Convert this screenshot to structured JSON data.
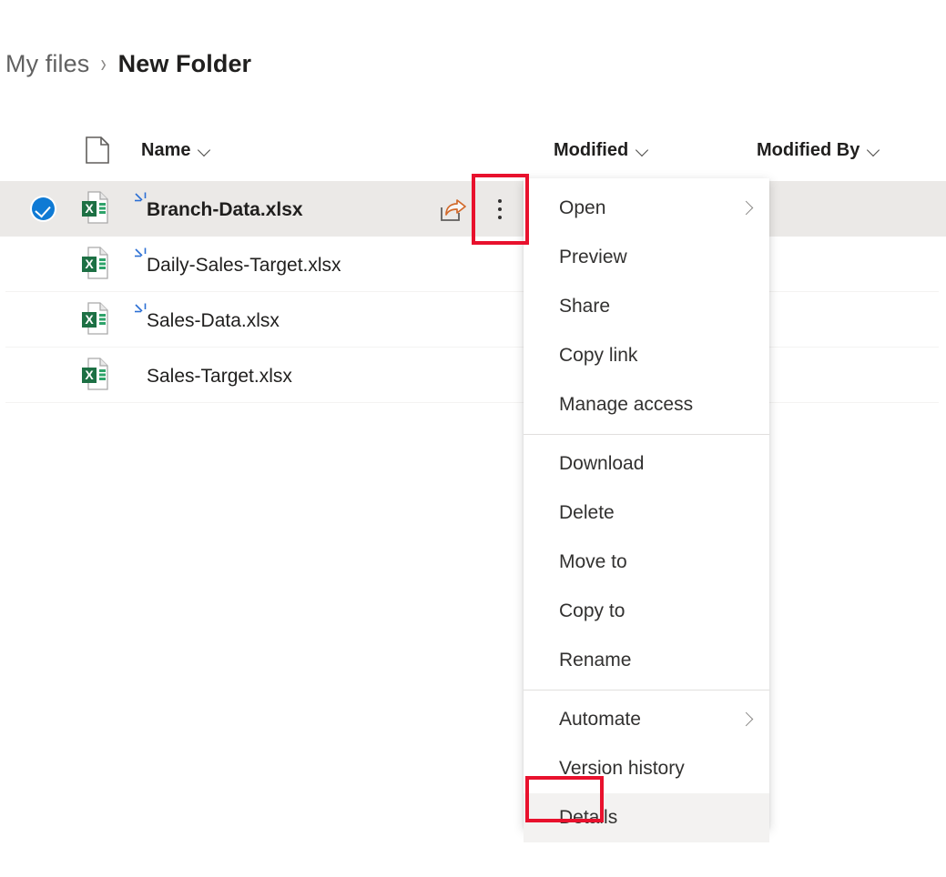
{
  "breadcrumb": {
    "root": "My files",
    "separator": "›",
    "current": "New Folder"
  },
  "columns": {
    "file_icon_name": "page-icon",
    "name": "Name",
    "modified": "Modified",
    "modified_by": "Modified By",
    "sort_chevron_icon": "chevron-down-icon"
  },
  "files": [
    {
      "name": "Branch-Data.xlsx",
      "type_icon": "excel-file-icon",
      "selected": true,
      "new_indicator": true,
      "modified": "",
      "modified_by": "",
      "share_icon": "share-icon",
      "more_icon": "more-vertical-icon"
    },
    {
      "name": "Daily-Sales-Target.xlsx",
      "type_icon": "excel-file-icon",
      "selected": false,
      "new_indicator": true,
      "modified": "",
      "modified_by": ""
    },
    {
      "name": "Sales-Data.xlsx",
      "type_icon": "excel-file-icon",
      "selected": false,
      "new_indicator": true,
      "modified": "",
      "modified_by": ""
    },
    {
      "name": "Sales-Target.xlsx",
      "type_icon": "excel-file-icon",
      "selected": false,
      "new_indicator": false,
      "modified": "",
      "modified_by": ""
    }
  ],
  "context_menu": {
    "groups": [
      {
        "items": [
          {
            "label": "Open",
            "submenu": true
          },
          {
            "label": "Preview",
            "submenu": false
          },
          {
            "label": "Share",
            "submenu": false
          },
          {
            "label": "Copy link",
            "submenu": false
          },
          {
            "label": "Manage access",
            "submenu": false
          }
        ]
      },
      {
        "items": [
          {
            "label": "Download",
            "submenu": false
          },
          {
            "label": "Delete",
            "submenu": false
          },
          {
            "label": "Move to",
            "submenu": false
          },
          {
            "label": "Copy to",
            "submenu": false
          },
          {
            "label": "Rename",
            "submenu": false
          }
        ]
      },
      {
        "items": [
          {
            "label": "Automate",
            "submenu": true
          },
          {
            "label": "Version history",
            "submenu": false
          },
          {
            "label": "Details",
            "submenu": false,
            "hovered": true
          }
        ]
      }
    ]
  },
  "annotations": [
    {
      "name": "more-button-highlight",
      "color": "#e8112d"
    },
    {
      "name": "details-item-highlight",
      "color": "#e8112d"
    }
  ],
  "colors": {
    "accent": "#0f7ad4",
    "selected_row": "#ebe9e7",
    "hover": "#f3f2f1",
    "annotation_red": "#e8112d",
    "excel_green": "#1d7044",
    "new_indicator_blue": "#2b6fd4"
  }
}
